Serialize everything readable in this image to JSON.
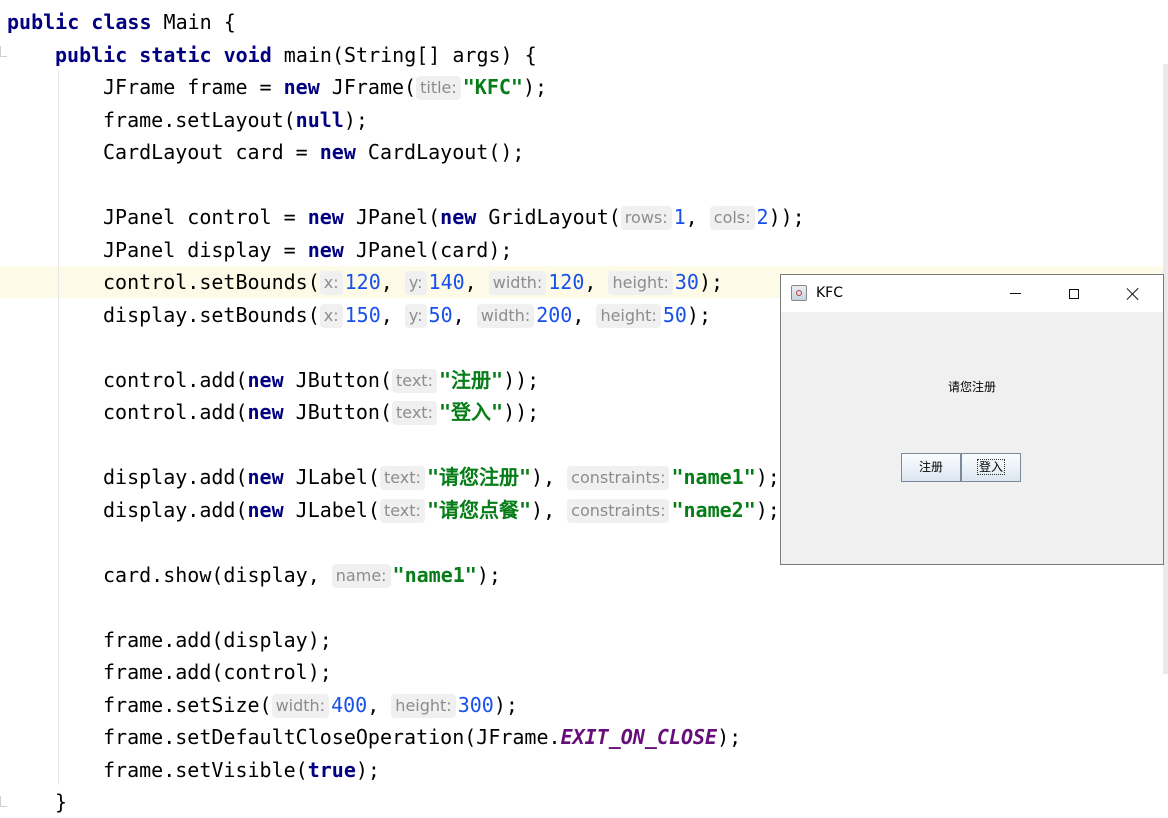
{
  "editor": {
    "lines": [
      {
        "indent": 0,
        "tokens": [
          {
            "t": "kw",
            "v": "public class "
          },
          {
            "t": "p",
            "v": "Main {"
          }
        ]
      },
      {
        "indent": 1,
        "tokens": [
          {
            "t": "kw",
            "v": "public static void "
          },
          {
            "t": "p",
            "v": "main(String[] args) {"
          }
        ]
      },
      {
        "indent": 2,
        "tokens": [
          {
            "t": "p",
            "v": "JFrame frame = "
          },
          {
            "t": "kw",
            "v": "new "
          },
          {
            "t": "p",
            "v": "JFrame("
          },
          {
            "t": "hint",
            "v": "title:"
          },
          {
            "t": "str",
            "v": "\"KFC\""
          },
          {
            "t": "p",
            "v": ");"
          }
        ]
      },
      {
        "indent": 2,
        "tokens": [
          {
            "t": "p",
            "v": "frame.setLayout("
          },
          {
            "t": "kw",
            "v": "null"
          },
          {
            "t": "p",
            "v": ");"
          }
        ]
      },
      {
        "indent": 2,
        "tokens": [
          {
            "t": "p",
            "v": "CardLayout card = "
          },
          {
            "t": "kw",
            "v": "new "
          },
          {
            "t": "p",
            "v": "CardLayout();"
          }
        ]
      },
      {
        "indent": 0,
        "tokens": []
      },
      {
        "indent": 2,
        "tokens": [
          {
            "t": "p",
            "v": "JPanel control = "
          },
          {
            "t": "kw",
            "v": "new "
          },
          {
            "t": "p",
            "v": "JPanel("
          },
          {
            "t": "kw",
            "v": "new "
          },
          {
            "t": "p",
            "v": "GridLayout("
          },
          {
            "t": "hint",
            "v": "rows:"
          },
          {
            "t": "num",
            "v": "1"
          },
          {
            "t": "p",
            "v": ", "
          },
          {
            "t": "hint",
            "v": "cols:"
          },
          {
            "t": "num",
            "v": "2"
          },
          {
            "t": "p",
            "v": "));"
          }
        ]
      },
      {
        "indent": 2,
        "tokens": [
          {
            "t": "p",
            "v": "JPanel display = "
          },
          {
            "t": "kw",
            "v": "new "
          },
          {
            "t": "p",
            "v": "JPanel(card);"
          }
        ]
      },
      {
        "indent": 2,
        "tokens": [
          {
            "t": "p",
            "v": "control.setBounds("
          },
          {
            "t": "hint",
            "v": "x:"
          },
          {
            "t": "num",
            "v": "120"
          },
          {
            "t": "p",
            "v": ", "
          },
          {
            "t": "hint",
            "v": "y:"
          },
          {
            "t": "num",
            "v": "140"
          },
          {
            "t": "p",
            "v": ", "
          },
          {
            "t": "hint",
            "v": "width:"
          },
          {
            "t": "num",
            "v": "120"
          },
          {
            "t": "p",
            "v": ", "
          },
          {
            "t": "hint",
            "v": "height:"
          },
          {
            "t": "num",
            "v": "30"
          },
          {
            "t": "p",
            "v": ");"
          }
        ]
      },
      {
        "indent": 2,
        "tokens": [
          {
            "t": "p",
            "v": "display.setBounds("
          },
          {
            "t": "hint",
            "v": "x:"
          },
          {
            "t": "num",
            "v": "150"
          },
          {
            "t": "p",
            "v": ", "
          },
          {
            "t": "hint",
            "v": "y:"
          },
          {
            "t": "num",
            "v": "50"
          },
          {
            "t": "p",
            "v": ", "
          },
          {
            "t": "hint",
            "v": "width:"
          },
          {
            "t": "num",
            "v": "200"
          },
          {
            "t": "p",
            "v": ", "
          },
          {
            "t": "hint",
            "v": "height:"
          },
          {
            "t": "num",
            "v": "50"
          },
          {
            "t": "p",
            "v": ");"
          }
        ]
      },
      {
        "indent": 0,
        "tokens": []
      },
      {
        "indent": 2,
        "tokens": [
          {
            "t": "p",
            "v": "control.add("
          },
          {
            "t": "kw",
            "v": "new "
          },
          {
            "t": "p",
            "v": "JButton("
          },
          {
            "t": "hint",
            "v": "text:"
          },
          {
            "t": "str",
            "v": "\"注册\""
          },
          {
            "t": "p",
            "v": "));"
          }
        ]
      },
      {
        "indent": 2,
        "tokens": [
          {
            "t": "p",
            "v": "control.add("
          },
          {
            "t": "kw",
            "v": "new "
          },
          {
            "t": "p",
            "v": "JButton("
          },
          {
            "t": "hint",
            "v": "text:"
          },
          {
            "t": "str",
            "v": "\"登入\""
          },
          {
            "t": "p",
            "v": "));"
          }
        ]
      },
      {
        "indent": 0,
        "tokens": []
      },
      {
        "indent": 2,
        "tokens": [
          {
            "t": "p",
            "v": "display.add("
          },
          {
            "t": "kw",
            "v": "new "
          },
          {
            "t": "p",
            "v": "JLabel("
          },
          {
            "t": "hint",
            "v": "text:"
          },
          {
            "t": "str",
            "v": "\"请您注册\""
          },
          {
            "t": "p",
            "v": "), "
          },
          {
            "t": "hint",
            "v": "constraints:"
          },
          {
            "t": "str",
            "v": "\"name1\""
          },
          {
            "t": "p",
            "v": ");"
          }
        ]
      },
      {
        "indent": 2,
        "tokens": [
          {
            "t": "p",
            "v": "display.add("
          },
          {
            "t": "kw",
            "v": "new "
          },
          {
            "t": "p",
            "v": "JLabel("
          },
          {
            "t": "hint",
            "v": "text:"
          },
          {
            "t": "str",
            "v": "\"请您点餐\""
          },
          {
            "t": "p",
            "v": "), "
          },
          {
            "t": "hint",
            "v": "constraints:"
          },
          {
            "t": "str",
            "v": "\"name2\""
          },
          {
            "t": "p",
            "v": ");"
          }
        ]
      },
      {
        "indent": 0,
        "tokens": []
      },
      {
        "indent": 2,
        "tokens": [
          {
            "t": "p",
            "v": "card.show(display, "
          },
          {
            "t": "hint",
            "v": "name:"
          },
          {
            "t": "str",
            "v": "\"name1\""
          },
          {
            "t": "p",
            "v": ");"
          }
        ]
      },
      {
        "indent": 0,
        "tokens": []
      },
      {
        "indent": 2,
        "tokens": [
          {
            "t": "p",
            "v": "frame.add(display);"
          }
        ]
      },
      {
        "indent": 2,
        "tokens": [
          {
            "t": "p",
            "v": "frame.add(control);"
          }
        ]
      },
      {
        "indent": 2,
        "tokens": [
          {
            "t": "p",
            "v": "frame.setSize("
          },
          {
            "t": "hint",
            "v": "width:"
          },
          {
            "t": "num",
            "v": "400"
          },
          {
            "t": "p",
            "v": ", "
          },
          {
            "t": "hint",
            "v": "height:"
          },
          {
            "t": "num",
            "v": "300"
          },
          {
            "t": "p",
            "v": ");"
          }
        ]
      },
      {
        "indent": 2,
        "tokens": [
          {
            "t": "p",
            "v": "frame.setDefaultCloseOperation(JFrame."
          },
          {
            "t": "const",
            "v": "EXIT_ON_CLOSE"
          },
          {
            "t": "p",
            "v": ");"
          }
        ]
      },
      {
        "indent": 2,
        "tokens": [
          {
            "t": "p",
            "v": "frame.setVisible("
          },
          {
            "t": "kw",
            "v": "true"
          },
          {
            "t": "p",
            "v": ");"
          }
        ]
      },
      {
        "indent": 1,
        "tokens": [
          {
            "t": "p",
            "v": "}"
          }
        ]
      }
    ]
  },
  "window": {
    "title": "KFC",
    "icon": "java-coffee-icon",
    "label": "请您注册",
    "buttons": [
      "注册",
      "登入"
    ]
  },
  "colors": {
    "keyword": "#000080",
    "string": "#067d17",
    "number": "#1750eb",
    "constant": "#660e7a",
    "hint": "#8c8c8c",
    "current_line": "#fdfbe8"
  }
}
